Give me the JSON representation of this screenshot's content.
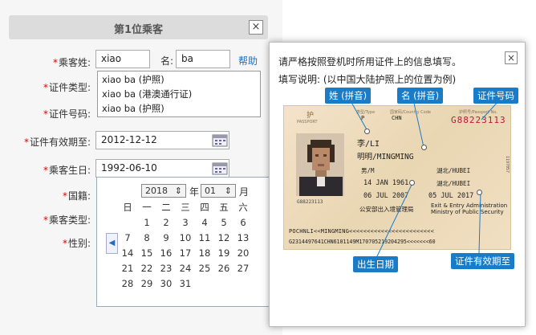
{
  "form": {
    "title": "第1位乘客",
    "close": "×",
    "surname_label": "乘客姓:",
    "surname_value": "xiao",
    "given_label": "名:",
    "given_value": "ba",
    "help_link": "帮助",
    "cert_type_label": "证件类型:",
    "cert_no_label": "证件号码:",
    "cert_valid_label": "证件有效期至:",
    "cert_valid_value": "2012-12-12",
    "birth_label": "乘客生日:",
    "birth_value": "1992-06-10",
    "nationality_label": "国籍:",
    "passenger_type_label": "乘客类型:",
    "gender_label": "性别:",
    "required_mark": "*"
  },
  "autocomplete": {
    "items": [
      "xiao ba (护照)",
      "xiao ba (港澳通行证)",
      "xiao ba (护照)"
    ]
  },
  "calendar": {
    "year": "2018",
    "year_unit": "年",
    "month": "01",
    "month_unit": "月",
    "weekdays": [
      "日",
      "一",
      "二",
      "三",
      "四",
      "五",
      "六"
    ],
    "days": [
      "1",
      "2",
      "3",
      "4",
      "5",
      "6",
      "7",
      "8",
      "9",
      "10",
      "11",
      "12",
      "13",
      "14",
      "15",
      "16",
      "17",
      "18",
      "19",
      "20",
      "21",
      "22",
      "23",
      "24",
      "25",
      "26",
      "27",
      "28",
      "29",
      "30",
      "31"
    ],
    "prev": "◀"
  },
  "help": {
    "instruction": "请严格按照登机时所用证件上的信息填写。",
    "subtitle": "填写说明: (以中国大陆护照上的位置为例)",
    "close": "×",
    "callouts": {
      "surname": "姓 (拼音)",
      "given": "名 (拼音)",
      "cert_no": "证件号码",
      "birth": "出生日期",
      "valid": "证件有效期至"
    }
  },
  "passport": {
    "passport_no": "G88223113",
    "cn_name_surname": "李/LI",
    "cn_name_given": "明明/MINGMING",
    "sex": "男/M",
    "birthplace": "湖北/HUBEI",
    "birth_date": "14 JAN 1961",
    "place_of_issue": "湖北/HUBEI",
    "issue_date": "06 JUL 2007",
    "expiry_date": "05 JUL 2017",
    "authority_cn": "公安部出入境管理局",
    "authority_en1": "Exit & Entry Administration",
    "authority_en2": "Ministry of Public Security",
    "mrz1": "POCHNLI<<MINGMING<<<<<<<<<<<<<<<<<<<<<<<<",
    "mrz2": "G2314497641CHN6101149M170705219204295<<<<<<<60",
    "type_cn": "护",
    "type_en": "PASSPORT",
    "type_code_label": "类型/Type",
    "country_label": "国家码/Country Code",
    "type_code": "P",
    "country": "CHN",
    "no_label": "护照号/Passport No.",
    "side_code": "1197057"
  }
}
